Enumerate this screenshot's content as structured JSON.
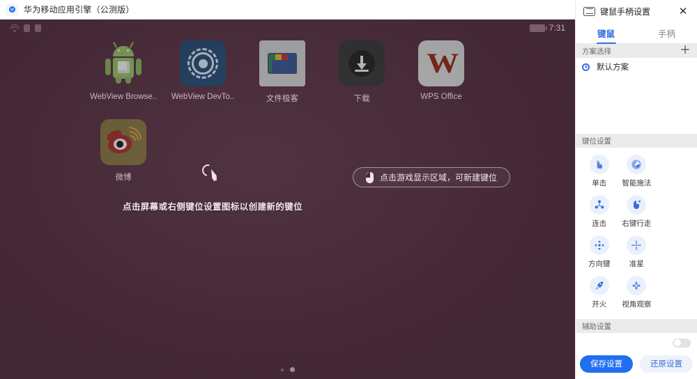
{
  "window": {
    "title": "华为移动应用引擎（公测版）",
    "app_icon": "blue-circle-icon"
  },
  "emulator": {
    "statusbar": {
      "wifi_icon": "wifi-icon",
      "sim_icon": "sim-card-icon",
      "sd_icon": "sd-card-icon",
      "battery_icon": "battery-icon",
      "time": "7:31"
    },
    "apps": [
      {
        "label": "WebView Browse..",
        "icon": "android-robot-icon"
      },
      {
        "label": "WebView DevTo..",
        "icon": "devtools-gear-icon"
      },
      {
        "label": "文件极客",
        "icon": "file-manager-icon"
      },
      {
        "label": "下载",
        "icon": "download-icon"
      },
      {
        "label": "WPS Office",
        "icon": "wps-office-icon"
      },
      {
        "label": "微博",
        "icon": "weibo-icon"
      }
    ],
    "hint": {
      "cursor_icon": "click-cursor-icon",
      "text": "点击屏幕或右侧键位设置图标以创建新的键位"
    },
    "pill": {
      "icon": "mouse-icon",
      "text": "点击游戏显示区域，可新建键位"
    },
    "page_dots": 2,
    "active_dot": 1,
    "background_color": "#4a2b3a"
  },
  "panel": {
    "icon": "keyboard-icon",
    "title": "键鼠手柄设置",
    "close_icon": "close-icon",
    "close_label": "✕",
    "tabs": [
      {
        "label": "键鼠",
        "active": true
      },
      {
        "label": "手柄",
        "active": false
      }
    ],
    "scheme_section": {
      "title": "方案选择",
      "add_icon": "plus-icon",
      "add_label": "＋",
      "items": [
        {
          "label": "默认方案",
          "selected": true
        }
      ]
    },
    "keys_section": {
      "title": "键位设置",
      "items": [
        {
          "label": "单击",
          "icon": "tap-icon"
        },
        {
          "label": "智能施法",
          "icon": "smart-cast-icon"
        },
        {
          "label": "连击",
          "icon": "combo-icon"
        },
        {
          "label": "右键行走",
          "icon": "right-click-walk-icon"
        },
        {
          "label": "方向键",
          "icon": "dpad-icon"
        },
        {
          "label": "准星",
          "icon": "crosshair-icon"
        },
        {
          "label": "开火",
          "icon": "fire-icon"
        },
        {
          "label": "视角观察",
          "icon": "view-look-icon"
        }
      ]
    },
    "aux_section": {
      "title": "辅助设置",
      "row_label": "",
      "toggle_icon": "toggle-switch"
    },
    "footer": {
      "save_label": "保存设置",
      "reset_label": "还原设置"
    },
    "accent_color": "#2f6fe4"
  }
}
